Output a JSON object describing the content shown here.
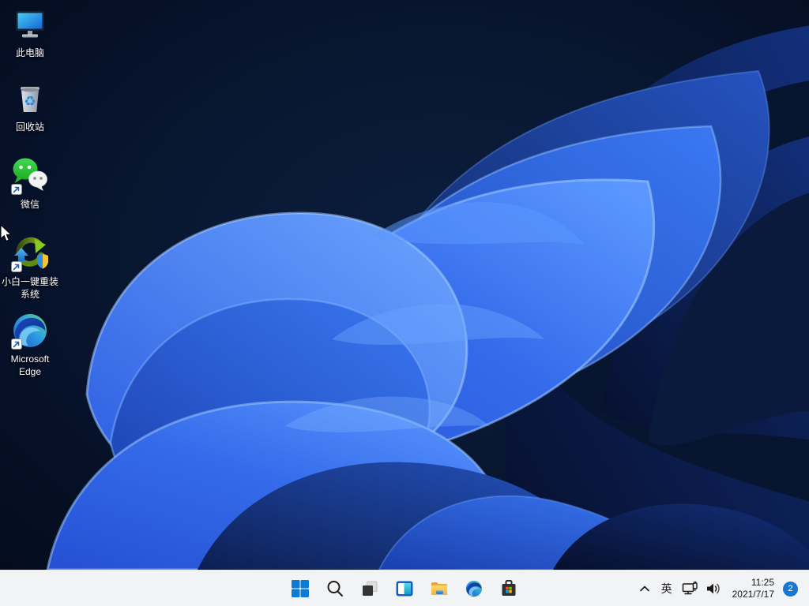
{
  "desktop": {
    "icons": [
      {
        "id": "this-pc",
        "label": "此电脑",
        "shortcut": false
      },
      {
        "id": "recycle-bin",
        "label": "回收站",
        "shortcut": false
      },
      {
        "id": "wechat",
        "label": "微信",
        "shortcut": true
      },
      {
        "id": "xiaobai-reinstall",
        "label": "小白一键重装系统",
        "shortcut": true
      },
      {
        "id": "microsoft-edge",
        "label": "Microsoft Edge",
        "shortcut": true
      }
    ],
    "wallpaper_name": "windows-11-bloom"
  },
  "taskbar": {
    "buttons": [
      {
        "id": "start",
        "icon": "windows-logo-icon"
      },
      {
        "id": "search",
        "icon": "magnifier-icon"
      },
      {
        "id": "task-view",
        "icon": "overlapping-squares-icon"
      },
      {
        "id": "widgets",
        "icon": "widgets-panel-icon"
      },
      {
        "id": "file-explorer",
        "icon": "folder-icon"
      },
      {
        "id": "edge-browser",
        "icon": "edge-swirl-icon"
      },
      {
        "id": "microsoft-store",
        "icon": "shopping-bag-icon"
      }
    ],
    "tray": {
      "ime_label": "英",
      "clock": {
        "time": "11:25",
        "date": "2021/7/17"
      },
      "notification_count": "2",
      "icons": [
        "chevron-up-icon",
        "network-icon",
        "volume-icon"
      ]
    }
  },
  "colors": {
    "taskbar_bg": "#f2f3f5",
    "badge_blue": "#1777d2",
    "wallpaper_dark": "#050e1f",
    "bloom_bright": "#3b76f0",
    "bloom_highlight": "#7db3ff"
  }
}
